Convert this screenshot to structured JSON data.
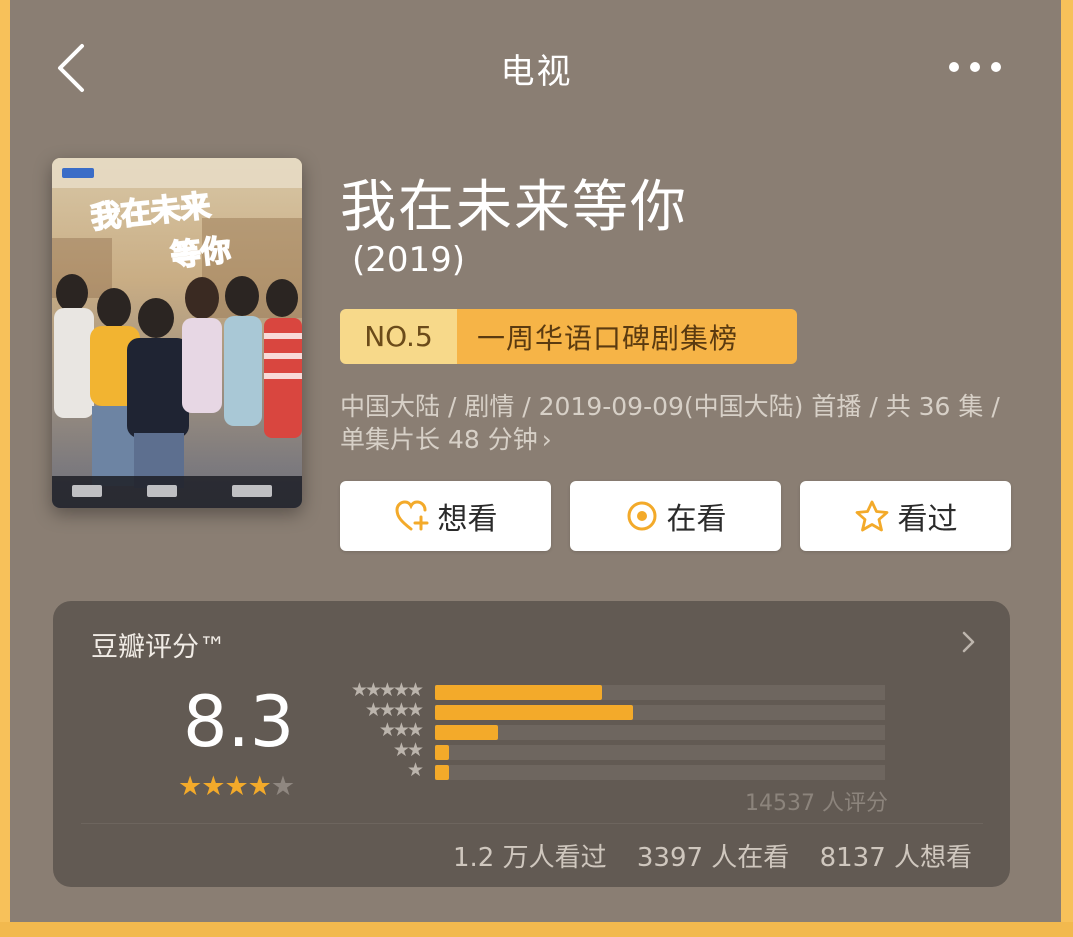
{
  "nav": {
    "title": "电视"
  },
  "show": {
    "title": "我在未来等你",
    "year": "(2019)",
    "rank": {
      "no": "NO.5",
      "label": "一周华语口碑剧集榜"
    },
    "meta": "中国大陆 / 剧情 / 2019-09-09(中国大陆) 首播 / 共 36 集 / 单集片长 48 分钟",
    "poster_text": {
      "title_art": "我在未来等你"
    }
  },
  "actions": {
    "want": "想看",
    "watching": "在看",
    "watched": "看过"
  },
  "rating": {
    "title": "豆瓣评分™",
    "score": "8.3",
    "star_level": 4,
    "distribution": [
      {
        "stars": "★★★★★",
        "fraction": 0.37
      },
      {
        "stars": "★★★★",
        "fraction": 0.44
      },
      {
        "stars": "★★★",
        "fraction": 0.14
      },
      {
        "stars": "★★",
        "fraction": 0.03
      },
      {
        "stars": "★",
        "fraction": 0.03
      }
    ],
    "raters": "14537 人评分",
    "stats": {
      "watched": "1.2 万人看过",
      "watching": "3397 人在看",
      "want": "8137 人想看"
    }
  },
  "colors": {
    "accent": "#f3aa2a",
    "badge_light": "#f7d98a",
    "badge_dark": "#f6b447",
    "background": "#8a7e73",
    "card": "#625a53"
  }
}
